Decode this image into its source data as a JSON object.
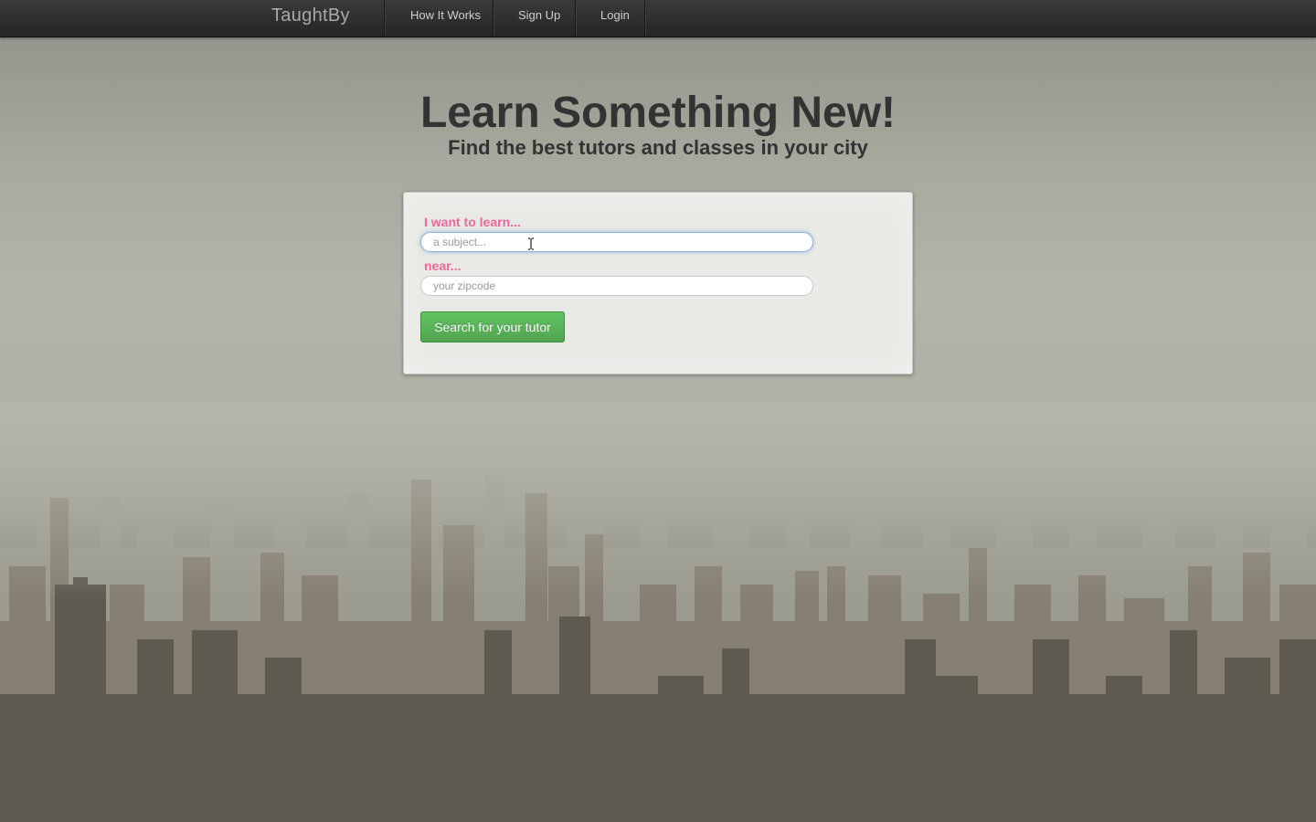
{
  "navbar": {
    "brand": "TaughtBy",
    "items": [
      {
        "label": "How It Works"
      },
      {
        "label": "Sign Up"
      },
      {
        "label": "Login"
      }
    ]
  },
  "hero": {
    "title": "Learn Something New!",
    "subtitle": "Find the best tutors and classes in your city"
  },
  "search_form": {
    "subject_label": "I want to learn...",
    "subject_placeholder": "a subject...",
    "subject_value": "",
    "location_label": "near...",
    "location_placeholder": "your zipcode",
    "location_value": "",
    "submit_label": "Search for your tutor"
  },
  "colors": {
    "label_pink": "#f0679a",
    "button_green": "#51a351",
    "navbar_dark": "#2b2b2b"
  }
}
